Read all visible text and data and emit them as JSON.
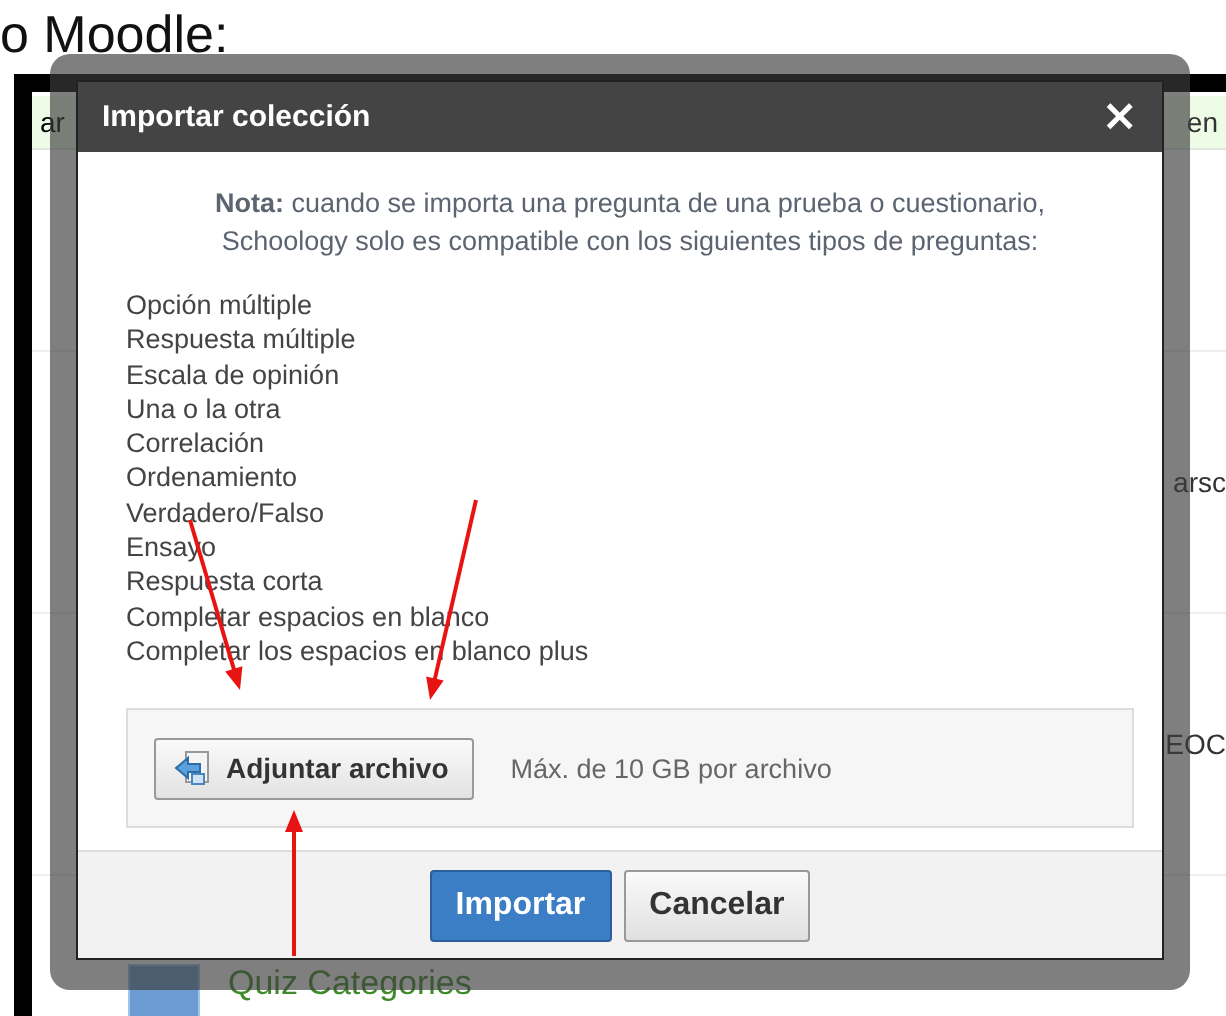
{
  "caption": "o Moodle:",
  "background": {
    "strip_left": "ar",
    "strip_right": "en",
    "row_right_1": "arsc",
    "row_right_2": "EOC",
    "item_title": "Quiz Categories"
  },
  "dialog": {
    "title": "Importar colección",
    "close": "×",
    "note": "**Nota:** cuando se importa una pregunta de una prueba o cuestionario, Schoology solo es compatible con los siguientes tipos de preguntas:",
    "question_types": [
      "Opción múltiple",
      "Respuesta múltiple",
      "Escala de opinión",
      "Una o la otra",
      "Correlación",
      "Ordenamiento",
      "Verdadero/Falso",
      "Ensayo",
      "Respuesta corta",
      "Completar espacios en blanco",
      "Completar los espacios en blanco plus"
    ],
    "attach_button": "Adjuntar archivo",
    "attach_hint": "Máx. de 10 GB por archivo",
    "buttons": [
      {
        "label": "Importar",
        "kind": "primary"
      },
      {
        "label": "Cancelar",
        "kind": "secondary"
      }
    ]
  },
  "annotations": [
    {
      "kind": "arrow"
    },
    {
      "kind": "arrow"
    },
    {
      "kind": "arrow"
    }
  ]
}
